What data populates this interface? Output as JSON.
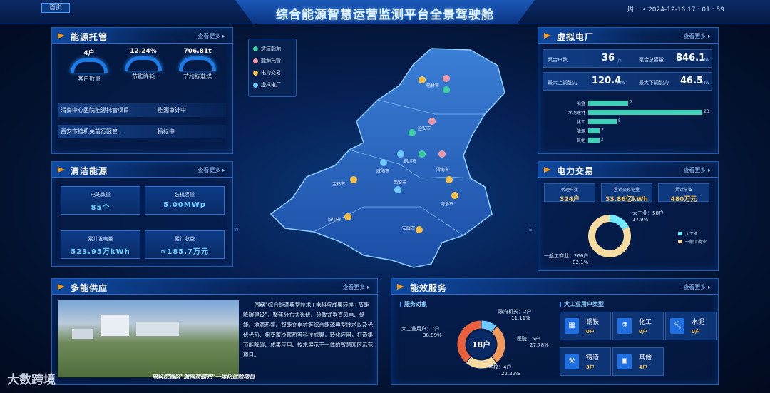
{
  "header": {
    "title": "综合能源智慧运营监测平台全景驾驶舱",
    "home": "首页",
    "datetime": "周一 • 2024-12-16 17 : 01 : 59"
  },
  "more": "查看更多",
  "energy_hosting": {
    "title": "能源托管",
    "gauges": [
      {
        "num": "4户",
        "label": "客户数量"
      },
      {
        "num": "12.24%",
        "label": "节能降耗"
      },
      {
        "num": "706.81t",
        "label": "节约标准煤"
      }
    ],
    "list": [
      {
        "name": "渭南中心医院能源托管项目",
        "status": "能源审计中"
      },
      {
        "name": "西安市档机关前行区管...",
        "status": "投标中"
      }
    ]
  },
  "clean_energy": {
    "title": "清洁能源",
    "stats": [
      {
        "k": "电站数量",
        "v": "85个"
      },
      {
        "k": "装机容量",
        "v": "5.00MWp"
      },
      {
        "k": "累计发电量",
        "v": "523.95万kWh"
      },
      {
        "k": "累计收益",
        "v": "≈185.7万元"
      }
    ]
  },
  "map": {
    "legend": [
      {
        "label": "清洁能源",
        "color": "#3fd0a0"
      },
      {
        "label": "能源托管",
        "color": "#f29aa8"
      },
      {
        "label": "电力交易",
        "color": "#f6c14a"
      },
      {
        "label": "虚拟电厂",
        "color": "#6fc8ff"
      }
    ],
    "cities": [
      "榆林市",
      "延安市",
      "铜川市",
      "渭南市",
      "咸阳市",
      "西安市",
      "宝鸡市",
      "商洛市",
      "汉中市",
      "安康市"
    ],
    "compass": [
      "W",
      "E"
    ]
  },
  "virtual_plant": {
    "title": "虚拟电厂",
    "rows": [
      {
        "k1": "聚合户数",
        "v1": "36",
        "u1": "户",
        "k2": "聚合总容量",
        "v2": "846.1",
        "u2": "MW"
      },
      {
        "k1": "最大上调能力",
        "v1": "120.4",
        "u1": "MW",
        "k2": "最大下调能力",
        "v2": "46.5",
        "u2": "MW"
      }
    ],
    "bars": [
      {
        "label": "冶金",
        "value": 7
      },
      {
        "label": "水泥建材",
        "value": 20
      },
      {
        "label": "化工",
        "value": 5
      },
      {
        "label": "能源",
        "value": 2
      },
      {
        "label": "其他",
        "value": 2
      }
    ]
  },
  "power_trade": {
    "title": "电力交易",
    "stats": [
      {
        "k": "代理户数",
        "v": "324户"
      },
      {
        "k": "累计交易电量",
        "v": "33.86亿kWh"
      },
      {
        "k": "累计节省",
        "v": "480万元"
      }
    ],
    "pie": [
      {
        "name": "大工业",
        "count": "58户",
        "pct": 17.9,
        "color": "#6fe8ff"
      },
      {
        "name": "一般工商业",
        "count": "266户",
        "pct": 82.1,
        "color": "#f6dca0"
      }
    ]
  },
  "multi_supply": {
    "title": "多能供应",
    "text": "围绕\"综合能源典型技术+电科院成果转换+节能降碳建设\"，聚焦分布式光伏、分散式垂直风电、储能、地源热泵、智能充电桩等综合能源典型技术以及光伏光热、相变蓄冷蓄热等科技成果，转化应用，打造集节能降碳、成果应用、技术展示于一体的智慧园区示范项目。",
    "caption": "电科院园区\"源网荷储充\"一体化试验项目"
  },
  "efficiency": {
    "title": "能效服务",
    "service_title": "服务对象",
    "center": "18户",
    "donut": [
      {
        "name": "政府机关",
        "count": "2户",
        "pct": 11.11,
        "color": "#6fc8ff"
      },
      {
        "name": "医院",
        "count": "5户",
        "pct": 27.78,
        "color": "#f29a5a"
      },
      {
        "name": "学校",
        "count": "4户",
        "pct": 22.22,
        "color": "#f6dca0"
      },
      {
        "name": "大工业用户",
        "count": "7户",
        "pct": 38.89,
        "color": "#e8603c"
      }
    ],
    "industry_title": "大工业用户类型",
    "industries": [
      {
        "name": "钢铁",
        "count": "0户",
        "icon": "steel-icon"
      },
      {
        "name": "化工",
        "count": "0户",
        "icon": "chemical-icon"
      },
      {
        "name": "水泥",
        "count": "0户",
        "icon": "cement-icon"
      },
      {
        "name": "铸造",
        "count": "3户",
        "icon": "casting-icon"
      },
      {
        "name": "其他",
        "count": "4户",
        "icon": "other-icon"
      }
    ]
  },
  "watermark": "大数跨境"
}
